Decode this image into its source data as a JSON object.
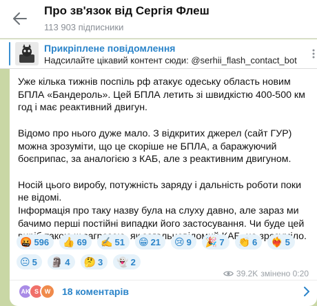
{
  "header": {
    "title": "Про зв'язок від Сергія Флеш",
    "subscribers": "113 903 підписники"
  },
  "pinned": {
    "title": "Прикріплене повідомлення",
    "text": "Надсилайте цікавий контент сюди: @serhii_flash_contact_bot"
  },
  "message": {
    "paragraphs": [
      "Уже кілька тижнів поспіль рф атакує одеську область новим БПЛА «Бандероль». Цей БПЛА летить зі швидкістю 400-500 км год і має реактивний двигун.",
      "Відомо про нього дуже мало. З відкритих джерел (сайт ГУР) можна зрозуміти, що це скоріше не БПЛА, а баражуючий боєприпас, за аналогією з КАБ, але з реактивним двигуном.",
      "Носій цього виробу, потужність заряду і дальність роботи поки не відомі.",
      "Інформація про таку назву була на слуху давно, але зараз ми бачимо перші постійні випадки його застосування. Чи буде цей виріб такою ж загрозою, як загальновідомий КАБ, не зрозуміло."
    ]
  },
  "reactions": [
    {
      "emoji": "🤬",
      "count": "596"
    },
    {
      "emoji": "👍",
      "count": "69"
    },
    {
      "emoji": "✍️",
      "count": "51"
    },
    {
      "emoji": "😁",
      "count": "21"
    },
    {
      "emoji": "😢",
      "count": "9"
    },
    {
      "emoji": "🎉",
      "count": "7"
    },
    {
      "emoji": "👏",
      "count": "6"
    },
    {
      "emoji": "❤️‍🔥",
      "count": "5"
    },
    {
      "emoji": "😐",
      "count": "5"
    },
    {
      "emoji": "🗿",
      "count": "4"
    },
    {
      "emoji": "🤔",
      "count": "3"
    },
    {
      "emoji": "👻",
      "count": "2"
    }
  ],
  "meta": {
    "views": "39.2K",
    "edited_time": "змінено 0:20"
  },
  "comments": {
    "label": "18 коментарів",
    "avatars": [
      {
        "initials": "AK",
        "color": "#a98be6"
      },
      {
        "initials": "S",
        "color": "#f0706a"
      },
      {
        "initials": "W",
        "color": "#f08a4b"
      }
    ]
  },
  "colors": {
    "accent": "#2b84c9",
    "chat_background": "#c9d7a5"
  }
}
